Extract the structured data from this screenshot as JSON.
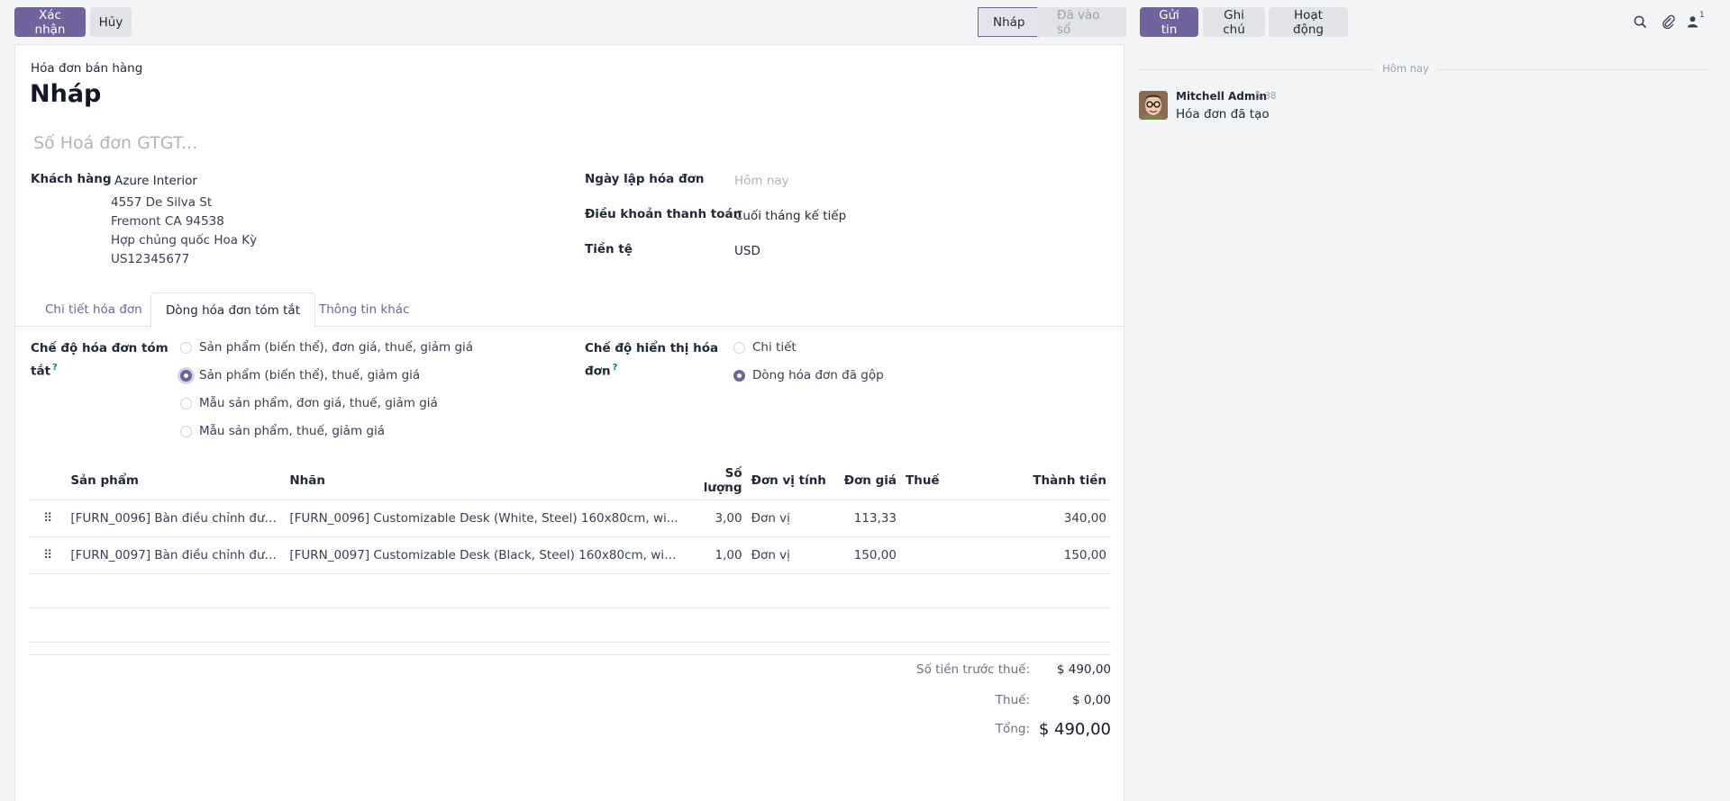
{
  "toolbar": {
    "confirm_label": "Xác nhận",
    "cancel_label": "Hủy"
  },
  "statusbar": {
    "draft_label": "Nháp",
    "posted_label": "Đã vào sổ"
  },
  "header": {
    "doc_type": "Hóa đơn bán hàng",
    "title": "Nháp",
    "vat_placeholder": "Số Hoá đơn GTGT..."
  },
  "customer": {
    "label": "Khách hàng",
    "name": "Azure Interior",
    "address_lines": [
      "4557 De Silva St",
      "Fremont CA 94538",
      "Hợp chủng quốc Hoa Kỳ",
      "US12345677"
    ]
  },
  "invoice_info": {
    "date_label": "Ngày lập hóa đơn",
    "date_placeholder": "Hôm nay",
    "terms_label": "Điều khoản thanh toán",
    "terms_value": "Cuối tháng kế tiếp",
    "currency_label": "Tiền tệ",
    "currency_value": "USD"
  },
  "tabs": [
    "Chi tiết hóa đơn",
    "Dòng hóa đơn tóm tắt",
    "Thông tin khác"
  ],
  "summary_mode": {
    "label_line1": "Chế độ hóa đơn tóm",
    "label_line2": "tắt",
    "help": "?",
    "options": [
      "Sản phẩm (biến thể), đơn giá, thuế, giảm giá",
      "Sản phẩm (biến thể), thuế, giảm giá",
      "Mẫu sản phẩm, đơn giá, thuế, giảm giá",
      "Mẫu sản phẩm, thuế, giảm giá"
    ],
    "selected_index": 1
  },
  "display_mode": {
    "label_line1": "Chế độ hiển thị hóa",
    "label_line2": "đơn",
    "help": "?",
    "options": [
      "Chi tiết",
      "Dòng hóa đơn đã gộp"
    ],
    "selected_index": 1
  },
  "lines_table": {
    "headers": [
      "Sản phẩm",
      "Nhãn",
      "Số lượng",
      "Đơn vị tính",
      "Đơn giá",
      "Thuế",
      "Thành tiền"
    ],
    "rows": [
      [
        "[FURN_0096] Bàn điều chỉnh được ...",
        "[FURN_0096] Customizable Desk (White, Steel) 160x80cm, wi...",
        "3,00",
        "Đơn vị",
        "113,33",
        "",
        "340,00"
      ],
      [
        "[FURN_0097] Bàn điều chỉnh được ...",
        "[FURN_0097] Customizable Desk (Black, Steel) 160x80cm, wit...",
        "1,00",
        "Đơn vị",
        "150,00",
        "",
        "150,00"
      ]
    ]
  },
  "totals": {
    "untaxed_label": "Số tiền trước thuế:",
    "untaxed_value": "$ 490,00",
    "tax_label": "Thuế:",
    "tax_value": "$ 0,00",
    "total_label": "Tổng:",
    "total_value": "$ 490,00"
  },
  "chatter": {
    "send_message_label": "Gửi tin",
    "log_note_label": "Ghi chú",
    "activity_label": "Hoạt động",
    "follower_count": "1",
    "today_label": "Hôm nay",
    "message": {
      "author": "Mitchell Admin",
      "time": "5:38",
      "body": "Hóa đơn đã tạo"
    }
  },
  "colors": {
    "primary": "#71639e",
    "link": "#71639e",
    "help": "#017e84"
  }
}
